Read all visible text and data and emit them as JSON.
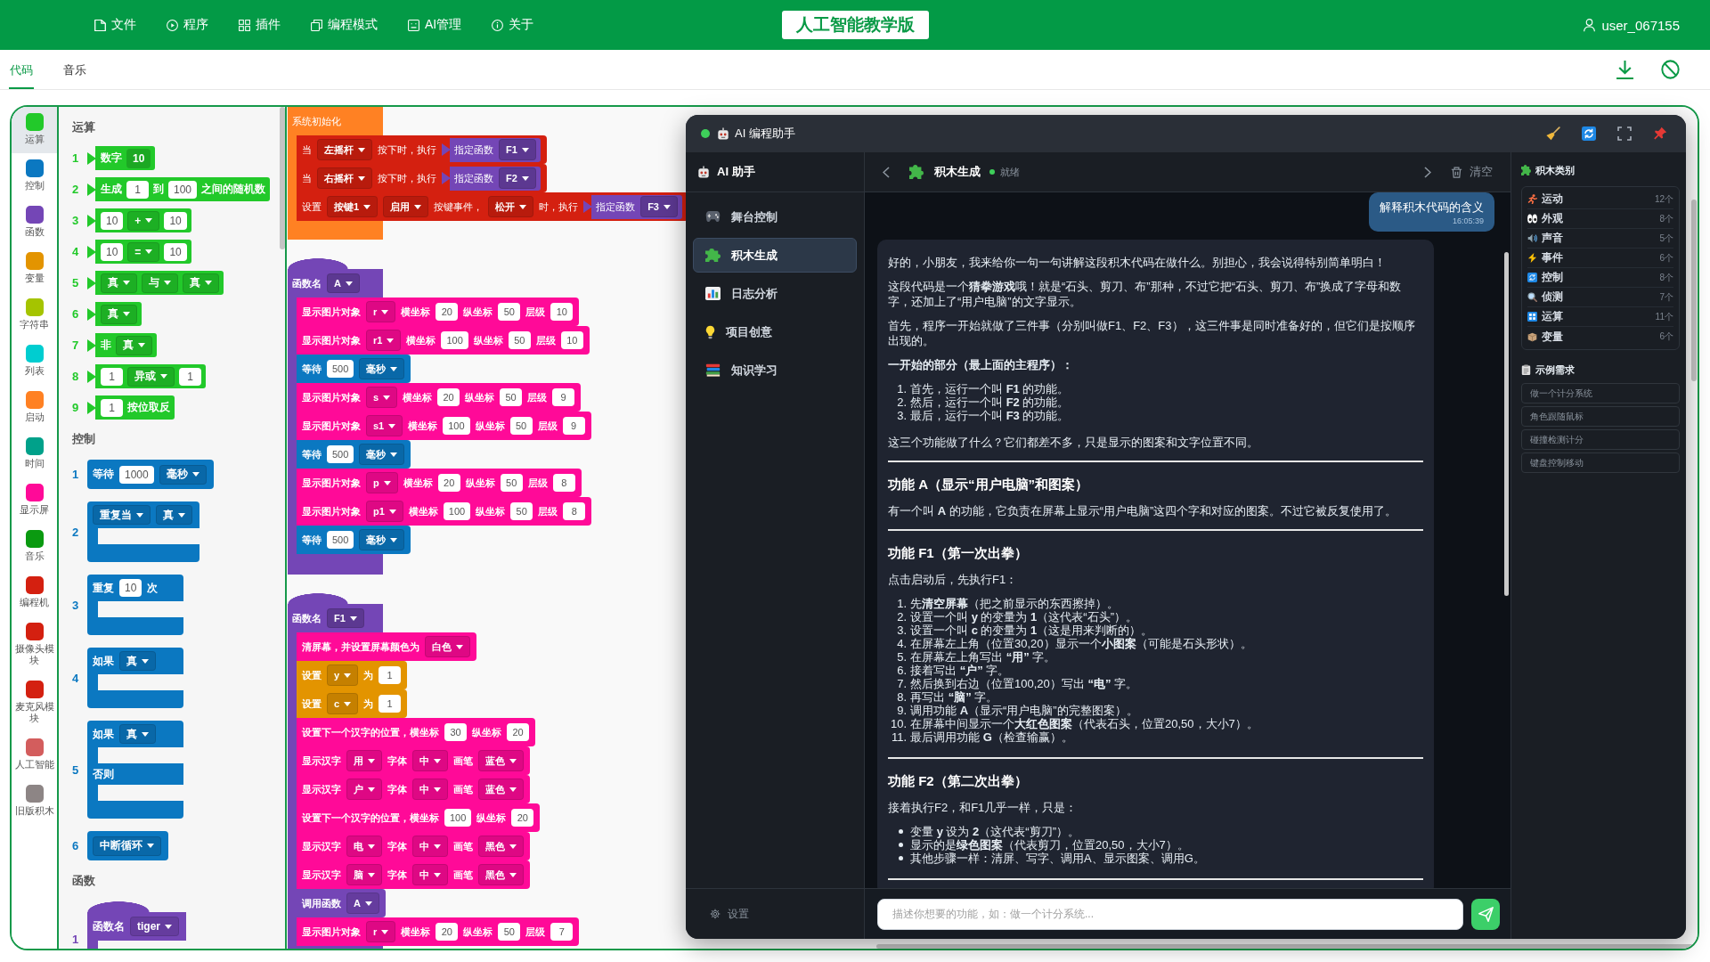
{
  "menu_bar": {
    "items": [
      {
        "label": "文件"
      },
      {
        "label": "程序"
      },
      {
        "label": "插件"
      },
      {
        "label": "编程模式"
      },
      {
        "label": "AI管理"
      },
      {
        "label": "关于"
      }
    ],
    "title": "人工智能教学版",
    "user": "user_067155"
  },
  "tabs": [
    {
      "label": "代码",
      "selected": true
    },
    {
      "label": "音乐",
      "selected": false
    }
  ],
  "categories": [
    {
      "label": "运算",
      "color": "#22c92a",
      "selected": true
    },
    {
      "label": "控制",
      "color": "#0b78c1",
      "selected": false
    },
    {
      "label": "函数",
      "color": "#7446b6",
      "selected": false
    },
    {
      "label": "变量",
      "color": "#e39400",
      "selected": false
    },
    {
      "label": "字符串",
      "color": "#a5c400",
      "selected": false
    },
    {
      "label": "列表",
      "color": "#00cdd0",
      "selected": false
    },
    {
      "label": "启动",
      "color": "#ff8123",
      "selected": false
    },
    {
      "label": "时间",
      "color": "#00a18a",
      "selected": false
    },
    {
      "label": "显示屏",
      "color": "#ff0a98",
      "selected": false
    },
    {
      "label": "音乐",
      "color": "#0a9a10",
      "selected": false
    },
    {
      "label": "编程机",
      "color": "#d42010",
      "selected": false
    },
    {
      "label": "摄像头模块",
      "color": "#d42010",
      "selected": false
    },
    {
      "label": "麦克风模块",
      "color": "#d42010",
      "selected": false
    },
    {
      "label": "人工智能",
      "color": "#d35d5d",
      "selected": false
    },
    {
      "label": "旧版积木",
      "color": "#8d8585",
      "selected": false
    }
  ],
  "palette": {
    "sections": [
      {
        "title": "运算",
        "color": "#22c92a",
        "blocks": [
          {
            "number": "1",
            "kind": "reporter",
            "parts": [
              {
                "kind": "text",
                "text": "数字"
              },
              {
                "kind": "field",
                "text": "10"
              }
            ]
          },
          {
            "number": "2",
            "kind": "reporter",
            "parts": [
              {
                "kind": "text",
                "text": "生成"
              },
              {
                "kind": "input",
                "text": "1"
              },
              {
                "kind": "text",
                "text": "到"
              },
              {
                "kind": "input",
                "text": "100"
              },
              {
                "kind": "text",
                "text": "之间的随机数"
              }
            ]
          },
          {
            "number": "3",
            "kind": "reporter",
            "parts": [
              {
                "kind": "input",
                "text": "10"
              },
              {
                "kind": "dropdown",
                "text": "+"
              },
              {
                "kind": "input",
                "text": "10"
              }
            ]
          },
          {
            "number": "4",
            "kind": "reporter",
            "parts": [
              {
                "kind": "input",
                "text": "10"
              },
              {
                "kind": "dropdown",
                "text": "="
              },
              {
                "kind": "input",
                "text": "10"
              }
            ]
          },
          {
            "number": "5",
            "kind": "reporter",
            "parts": [
              {
                "kind": "dropdown",
                "text": "真"
              },
              {
                "kind": "dropdown",
                "text": "与"
              },
              {
                "kind": "dropdown",
                "text": "真"
              }
            ]
          },
          {
            "number": "6",
            "kind": "reporter",
            "parts": [
              {
                "kind": "dropdown",
                "text": "真"
              }
            ]
          },
          {
            "number": "7",
            "kind": "reporter",
            "parts": [
              {
                "kind": "text",
                "text": "非"
              },
              {
                "kind": "dropdown",
                "text": "真"
              }
            ]
          },
          {
            "number": "8",
            "kind": "reporter",
            "parts": [
              {
                "kind": "input",
                "text": "1"
              },
              {
                "kind": "dropdown",
                "text": "异或"
              },
              {
                "kind": "input",
                "text": "1"
              }
            ]
          },
          {
            "number": "9",
            "kind": "reporter",
            "parts": [
              {
                "kind": "input",
                "text": "1"
              },
              {
                "kind": "text",
                "text": "按位取反"
              }
            ]
          }
        ]
      },
      {
        "title": "控制",
        "color": "#0b78c1",
        "blocks": [
          {
            "number": "1",
            "kind": "statement",
            "parts": [
              {
                "kind": "text",
                "text": "等待"
              },
              {
                "kind": "input",
                "text": "1000"
              },
              {
                "kind": "dropdown",
                "text": "毫秒"
              }
            ]
          },
          {
            "number": "2",
            "kind": "c_block",
            "sections": [
              {
                "parts": [
                  {
                    "kind": "dropdown",
                    "text": "重复当"
                  },
                  {
                    "kind": "dropdown",
                    "text": "真"
                  }
                ]
              }
            ]
          },
          {
            "number": "3",
            "kind": "c_block",
            "sections": [
              {
                "parts": [
                  {
                    "kind": "text",
                    "text": "重复"
                  },
                  {
                    "kind": "input",
                    "text": "10"
                  },
                  {
                    "kind": "text",
                    "text": "次"
                  }
                ]
              }
            ]
          },
          {
            "number": "4",
            "kind": "c_block",
            "sections": [
              {
                "parts": [
                  {
                    "kind": "text",
                    "text": "如果"
                  },
                  {
                    "kind": "dropdown",
                    "text": "真"
                  }
                ]
              }
            ]
          },
          {
            "number": "5",
            "kind": "c_block",
            "sections": [
              {
                "parts": [
                  {
                    "kind": "text",
                    "text": "如果"
                  },
                  {
                    "kind": "dropdown",
                    "text": "真"
                  }
                ]
              },
              {
                "parts": [
                  {
                    "kind": "text",
                    "text": "否则"
                  }
                ]
              }
            ]
          },
          {
            "number": "6",
            "kind": "statement",
            "parts": [
              {
                "kind": "dropdown",
                "text": "中断循环"
              }
            ]
          }
        ]
      },
      {
        "title": "函数",
        "color": "#7446b6",
        "blocks": [
          {
            "number": "1",
            "kind": "hat",
            "parts": [
              {
                "kind": "text",
                "text": "函数名"
              },
              {
                "kind": "dropdown",
                "text": "tiger"
              }
            ]
          }
        ]
      }
    ]
  },
  "workspace": {
    "scripts": [
      {
        "kind": "event_hat",
        "color": "#ff8123",
        "parts": [
          {
            "kind": "text",
            "text": "系统初始化"
          }
        ],
        "blocks": [
          {
            "color": "#d42010",
            "parts": [
              {
                "kind": "text",
                "text": "当"
              },
              {
                "kind": "dropdown",
                "text": "左摇杆"
              },
              {
                "kind": "text",
                "text": "按下时，执行"
              },
              {
                "kind": "reporter",
                "color": "#7446b6",
                "parts": [
                  {
                    "kind": "text",
                    "text": "指定函数"
                  },
                  {
                    "kind": "dropdown",
                    "text": "F1"
                  }
                ]
              }
            ]
          },
          {
            "color": "#d42010",
            "parts": [
              {
                "kind": "text",
                "text": "当"
              },
              {
                "kind": "dropdown",
                "text": "右摇杆"
              },
              {
                "kind": "text",
                "text": "按下时，执行"
              },
              {
                "kind": "reporter",
                "color": "#7446b6",
                "parts": [
                  {
                    "kind": "text",
                    "text": "指定函数"
                  },
                  {
                    "kind": "dropdown",
                    "text": "F2"
                  }
                ]
              }
            ]
          },
          {
            "color": "#d42010",
            "parts": [
              {
                "kind": "text",
                "text": "设置"
              },
              {
                "kind": "dropdown",
                "text": "按键1"
              },
              {
                "kind": "dropdown",
                "text": "启用"
              },
              {
                "kind": "text",
                "text": "按键事件，"
              },
              {
                "kind": "dropdown",
                "text": "松开"
              },
              {
                "kind": "text",
                "text": "时，执行"
              },
              {
                "kind": "reporter",
                "color": "#7446b6",
                "parts": [
                  {
                    "kind": "text",
                    "text": "指定函数"
                  },
                  {
                    "kind": "dropdown",
                    "text": "F3"
                  }
                ]
              }
            ]
          }
        ]
      },
      {
        "kind": "function_hat",
        "color": "#7446b6",
        "parts": [
          {
            "kind": "text",
            "text": "函数名"
          },
          {
            "kind": "dropdown",
            "text": "A"
          }
        ],
        "blocks": [
          {
            "color": "#ff0a98",
            "parts": [
              {
                "kind": "text",
                "text": "显示图片对象"
              },
              {
                "kind": "dropdown",
                "text": "r"
              },
              {
                "kind": "text",
                "text": "横坐标"
              },
              {
                "kind": "input",
                "text": "20"
              },
              {
                "kind": "text",
                "text": "纵坐标"
              },
              {
                "kind": "input",
                "text": "50"
              },
              {
                "kind": "text",
                "text": "层级"
              },
              {
                "kind": "input",
                "text": "10"
              }
            ]
          },
          {
            "color": "#ff0a98",
            "parts": [
              {
                "kind": "text",
                "text": "显示图片对象"
              },
              {
                "kind": "dropdown",
                "text": "r1"
              },
              {
                "kind": "text",
                "text": "横坐标"
              },
              {
                "kind": "input",
                "text": "100"
              },
              {
                "kind": "text",
                "text": "纵坐标"
              },
              {
                "kind": "input",
                "text": "50"
              },
              {
                "kind": "text",
                "text": "层级"
              },
              {
                "kind": "input",
                "text": "10"
              }
            ]
          },
          {
            "color": "#0b78c1",
            "parts": [
              {
                "kind": "text",
                "text": "等待"
              },
              {
                "kind": "input",
                "text": "500"
              },
              {
                "kind": "dropdown",
                "text": "毫秒"
              }
            ]
          },
          {
            "color": "#ff0a98",
            "parts": [
              {
                "kind": "text",
                "text": "显示图片对象"
              },
              {
                "kind": "dropdown",
                "text": "s"
              },
              {
                "kind": "text",
                "text": "横坐标"
              },
              {
                "kind": "input",
                "text": "20"
              },
              {
                "kind": "text",
                "text": "纵坐标"
              },
              {
                "kind": "input",
                "text": "50"
              },
              {
                "kind": "text",
                "text": "层级"
              },
              {
                "kind": "input",
                "text": "9"
              }
            ]
          },
          {
            "color": "#ff0a98",
            "parts": [
              {
                "kind": "text",
                "text": "显示图片对象"
              },
              {
                "kind": "dropdown",
                "text": "s1"
              },
              {
                "kind": "text",
                "text": "横坐标"
              },
              {
                "kind": "input",
                "text": "100"
              },
              {
                "kind": "text",
                "text": "纵坐标"
              },
              {
                "kind": "input",
                "text": "50"
              },
              {
                "kind": "text",
                "text": "层级"
              },
              {
                "kind": "input",
                "text": "9"
              }
            ]
          },
          {
            "color": "#0b78c1",
            "parts": [
              {
                "kind": "text",
                "text": "等待"
              },
              {
                "kind": "input",
                "text": "500"
              },
              {
                "kind": "dropdown",
                "text": "毫秒"
              }
            ]
          },
          {
            "color": "#ff0a98",
            "parts": [
              {
                "kind": "text",
                "text": "显示图片对象"
              },
              {
                "kind": "dropdown",
                "text": "p"
              },
              {
                "kind": "text",
                "text": "横坐标"
              },
              {
                "kind": "input",
                "text": "20"
              },
              {
                "kind": "text",
                "text": "纵坐标"
              },
              {
                "kind": "input",
                "text": "50"
              },
              {
                "kind": "text",
                "text": "层级"
              },
              {
                "kind": "input",
                "text": "8"
              }
            ]
          },
          {
            "color": "#ff0a98",
            "parts": [
              {
                "kind": "text",
                "text": "显示图片对象"
              },
              {
                "kind": "dropdown",
                "text": "p1"
              },
              {
                "kind": "text",
                "text": "横坐标"
              },
              {
                "kind": "input",
                "text": "100"
              },
              {
                "kind": "text",
                "text": "纵坐标"
              },
              {
                "kind": "input",
                "text": "50"
              },
              {
                "kind": "text",
                "text": "层级"
              },
              {
                "kind": "input",
                "text": "8"
              }
            ]
          },
          {
            "color": "#0b78c1",
            "parts": [
              {
                "kind": "text",
                "text": "等待"
              },
              {
                "kind": "input",
                "text": "500"
              },
              {
                "kind": "dropdown",
                "text": "毫秒"
              }
            ]
          }
        ]
      },
      {
        "kind": "function_hat",
        "color": "#7446b6",
        "parts": [
          {
            "kind": "text",
            "text": "函数名"
          },
          {
            "kind": "dropdown",
            "text": "F1"
          }
        ],
        "blocks": [
          {
            "color": "#ff0a98",
            "parts": [
              {
                "kind": "text",
                "text": "清屏幕，并设置屏幕颜色为"
              },
              {
                "kind": "dropdown",
                "text": "白色"
              }
            ]
          },
          {
            "color": "#e39400",
            "parts": [
              {
                "kind": "text",
                "text": "设置"
              },
              {
                "kind": "dropdown",
                "text": "y"
              },
              {
                "kind": "text",
                "text": "为"
              },
              {
                "kind": "input",
                "text": "1"
              }
            ]
          },
          {
            "color": "#e39400",
            "parts": [
              {
                "kind": "text",
                "text": "设置"
              },
              {
                "kind": "dropdown",
                "text": "c"
              },
              {
                "kind": "text",
                "text": "为"
              },
              {
                "kind": "input",
                "text": "1"
              }
            ]
          },
          {
            "color": "#ff0a98",
            "parts": [
              {
                "kind": "text",
                "text": "设置下一个汉字的位置，横坐标"
              },
              {
                "kind": "input",
                "text": "30"
              },
              {
                "kind": "text",
                "text": "纵坐标"
              },
              {
                "kind": "input",
                "text": "20"
              }
            ]
          },
          {
            "color": "#ff0a98",
            "parts": [
              {
                "kind": "text",
                "text": "显示汉字"
              },
              {
                "kind": "dropdown",
                "text": "用"
              },
              {
                "kind": "text",
                "text": "字体"
              },
              {
                "kind": "dropdown",
                "text": "中"
              },
              {
                "kind": "text",
                "text": "画笔"
              },
              {
                "kind": "dropdown",
                "text": "蓝色"
              }
            ]
          },
          {
            "color": "#ff0a98",
            "parts": [
              {
                "kind": "text",
                "text": "显示汉字"
              },
              {
                "kind": "dropdown",
                "text": "户"
              },
              {
                "kind": "text",
                "text": "字体"
              },
              {
                "kind": "dropdown",
                "text": "中"
              },
              {
                "kind": "text",
                "text": "画笔"
              },
              {
                "kind": "dropdown",
                "text": "蓝色"
              }
            ]
          },
          {
            "color": "#ff0a98",
            "parts": [
              {
                "kind": "text",
                "text": "设置下一个汉字的位置，横坐标"
              },
              {
                "kind": "input",
                "text": "100"
              },
              {
                "kind": "text",
                "text": "纵坐标"
              },
              {
                "kind": "input",
                "text": "20"
              }
            ]
          },
          {
            "color": "#ff0a98",
            "parts": [
              {
                "kind": "text",
                "text": "显示汉字"
              },
              {
                "kind": "dropdown",
                "text": "电"
              },
              {
                "kind": "text",
                "text": "字体"
              },
              {
                "kind": "dropdown",
                "text": "中"
              },
              {
                "kind": "text",
                "text": "画笔"
              },
              {
                "kind": "dropdown",
                "text": "黑色"
              }
            ]
          },
          {
            "color": "#ff0a98",
            "parts": [
              {
                "kind": "text",
                "text": "显示汉字"
              },
              {
                "kind": "dropdown",
                "text": "脑"
              },
              {
                "kind": "text",
                "text": "字体"
              },
              {
                "kind": "dropdown",
                "text": "中"
              },
              {
                "kind": "text",
                "text": "画笔"
              },
              {
                "kind": "dropdown",
                "text": "黑色"
              }
            ]
          },
          {
            "color": "#7446b6",
            "parts": [
              {
                "kind": "text",
                "text": "调用函数"
              },
              {
                "kind": "dropdown",
                "text": "A"
              }
            ]
          },
          {
            "color": "#ff0a98",
            "parts": [
              {
                "kind": "text",
                "text": "显示图片对象"
              },
              {
                "kind": "dropdown",
                "text": "r"
              },
              {
                "kind": "text",
                "text": "横坐标"
              },
              {
                "kind": "input",
                "text": "20"
              },
              {
                "kind": "text",
                "text": "纵坐标"
              },
              {
                "kind": "input",
                "text": "50"
              },
              {
                "kind": "text",
                "text": "层级"
              },
              {
                "kind": "input",
                "text": "7"
              }
            ]
          }
        ]
      }
    ]
  },
  "ai_panel": {
    "title": "AI 编程助手",
    "online": true,
    "nav": {
      "title": "AI 助手",
      "items": [
        {
          "label": "舞台控制",
          "selected": false
        },
        {
          "label": "积木生成",
          "selected": true
        },
        {
          "label": "日志分析",
          "selected": false
        },
        {
          "label": "项目创意",
          "selected": false
        },
        {
          "label": "知识学习",
          "selected": false
        }
      ],
      "settings": "设置"
    },
    "chat": {
      "title": "积木生成",
      "ready": true,
      "status": "就绪",
      "clear": "清空",
      "messages": [
        {
          "kind": "user",
          "text": "解释积木代码的含义",
          "time": "16:05:39"
        },
        {
          "kind": "assistant",
          "blocks": [
            {
              "kind": "p",
              "text": "好的，小朋友，我来给你一句一句讲解这段积木代码在做什么。别担心，我会说得特别简单明白！"
            },
            {
              "kind": "p",
              "text": "这段代码是一个**猜拳游戏**哦！就是“石头、剪刀、布”那种，不过它把“石头、剪刀、布”换成了字母和数字，还加上了“用户电脑”的文字显示。"
            },
            {
              "kind": "p",
              "text": "首先，程序一开始就做了三件事（分别叫做F1、F2、F3），这三件事是同时准备好的，但它们是按顺序出现的。"
            },
            {
              "kind": "strong",
              "text": "一开始的部分（最上面的主程序）："
            },
            {
              "kind": "ol",
              "items": [
                {
                  "number": "1.",
                  "text": "首先，运行一个叫 **F1** 的功能。"
                },
                {
                  "number": "2.",
                  "text": "然后，运行一个叫 **F2** 的功能。"
                },
                {
                  "number": "3.",
                  "text": "最后，运行一个叫 **F3** 的功能。"
                }
              ]
            },
            {
              "kind": "p",
              "text": "这三个功能做了什么？它们都差不多，只是显示的图案和文字位置不同。"
            },
            {
              "kind": "hr"
            },
            {
              "kind": "h",
              "text": "功能 A（显示“用户电脑”和图案）"
            },
            {
              "kind": "p",
              "text": "有一个叫 **A** 的功能，它负责在屏幕上显示“用户电脑”这四个字和对应的图案。不过它被反复使用了。"
            },
            {
              "kind": "hr"
            },
            {
              "kind": "h",
              "text": "功能 F1（第一次出拳）"
            },
            {
              "kind": "p",
              "text": "点击启动后，先执行F1："
            },
            {
              "kind": "ol",
              "items": [
                {
                  "number": "1.",
                  "text": "先**清空屏幕**（把之前显示的东西擦掉）。"
                },
                {
                  "number": "2.",
                  "text": "设置一个叫 **y** 的变量为 **1**（这代表“石头”）。"
                },
                {
                  "number": "3.",
                  "text": "设置一个叫 **c** 的变量为 **1**（这是用来判断的）。"
                },
                {
                  "number": "4.",
                  "text": "在屏幕左上角（位置30,20）显示一个**小图案**（可能是石头形状）。"
                },
                {
                  "number": "5.",
                  "text": "在屏幕左上角写出 **“用”** 字。"
                },
                {
                  "number": "6.",
                  "text": "接着写出 **“户”** 字。"
                },
                {
                  "number": "7.",
                  "text": "然后换到右边（位置100,20）写出 **“电”** 字。"
                },
                {
                  "number": "8.",
                  "text": "再写出 **“脑”** 字。"
                },
                {
                  "number": "9.",
                  "text": "调用功能 **A**（显示“用户电脑”的完整图案）。"
                },
                {
                  "number": "10.",
                  "text": "在屏幕中间显示一个**大红色图案**（代表石头，位置20,50，大小7）。"
                },
                {
                  "number": "11.",
                  "text": "最后调用功能 **G**（检查输赢）。"
                }
              ]
            },
            {
              "kind": "hr"
            },
            {
              "kind": "h",
              "text": "功能 F2（第二次出拳）"
            },
            {
              "kind": "p",
              "text": "接着执行F2，和F1几乎一样，只是："
            },
            {
              "kind": "ul",
              "items": [
                {
                  "text": "变量 **y** 设为 **2**（这代表“剪刀”）。"
                },
                {
                  "text": "显示的是**绿色图案**（代表剪刀，位置20,50，大小7）。"
                },
                {
                  "text": "其他步骤一样：清屏、写字、调用A、显示图案、调用G。"
                }
              ]
            },
            {
              "kind": "hr"
            }
          ]
        }
      ],
      "input": {
        "placeholder": "描述你想要的功能，如：做一个计分系统..."
      }
    },
    "side": {
      "categories_title": "积木类别",
      "categories": [
        {
          "label": "运动",
          "count": "12个"
        },
        {
          "label": "外观",
          "count": "8个"
        },
        {
          "label": "声音",
          "count": "5个"
        },
        {
          "label": "事件",
          "count": "6个"
        },
        {
          "label": "控制",
          "count": "8个"
        },
        {
          "label": "侦测",
          "count": "7个"
        },
        {
          "label": "运算",
          "count": "11个"
        },
        {
          "label": "变量",
          "count": "6个"
        }
      ],
      "examples_title": "示例需求",
      "examples": [
        "做一个计分系统",
        "角色跟随鼠标",
        "碰撞检测计分",
        "键盘控制移动"
      ]
    }
  }
}
